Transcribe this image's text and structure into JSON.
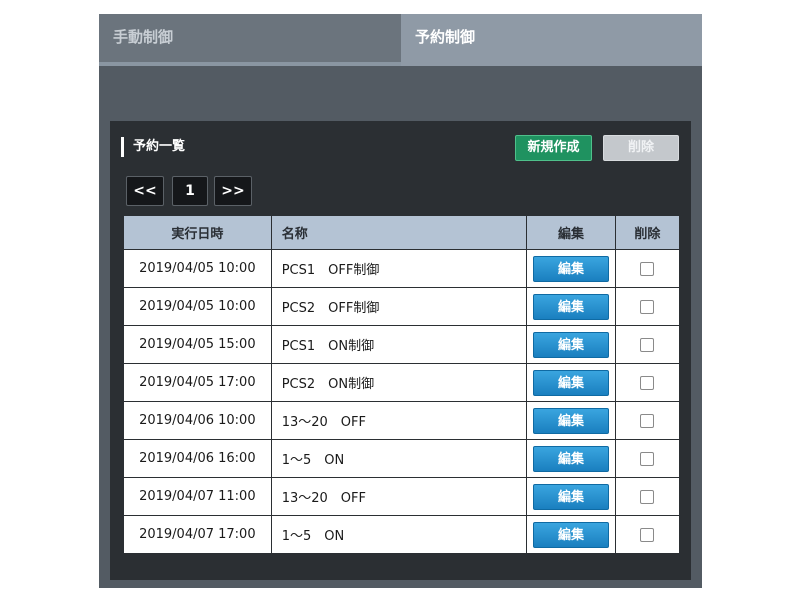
{
  "tabs": [
    {
      "label": "手動制御",
      "active": false
    },
    {
      "label": "予約制御",
      "active": true
    }
  ],
  "panel": {
    "title": "予約一覧",
    "new_button": "新規作成",
    "delete_button": "削除"
  },
  "pager": {
    "prev": "<<",
    "page": "1",
    "next": ">>"
  },
  "table": {
    "headers": [
      "実行日時",
      "名称",
      "編集",
      "削除"
    ],
    "edit_label": "編集",
    "rows": [
      {
        "datetime": "2019/04/05 10:00",
        "name": "PCS1　OFF制御"
      },
      {
        "datetime": "2019/04/05 10:00",
        "name": "PCS2　OFF制御"
      },
      {
        "datetime": "2019/04/05 15:00",
        "name": "PCS1　ON制御"
      },
      {
        "datetime": "2019/04/05 17:00",
        "name": "PCS2　ON制御"
      },
      {
        "datetime": "2019/04/06 10:00",
        "name": "13〜20　OFF"
      },
      {
        "datetime": "2019/04/06 16:00",
        "name": "1〜5　ON"
      },
      {
        "datetime": "2019/04/07 11:00",
        "name": "13〜20　OFF"
      },
      {
        "datetime": "2019/04/07 17:00",
        "name": "1〜5　ON"
      }
    ]
  },
  "colors": {
    "frame": "#535b63",
    "panel": "#2b2f33",
    "header": "#b4c3d4",
    "new_button": "#1f9260",
    "edit_button": "#1a7fbf"
  }
}
